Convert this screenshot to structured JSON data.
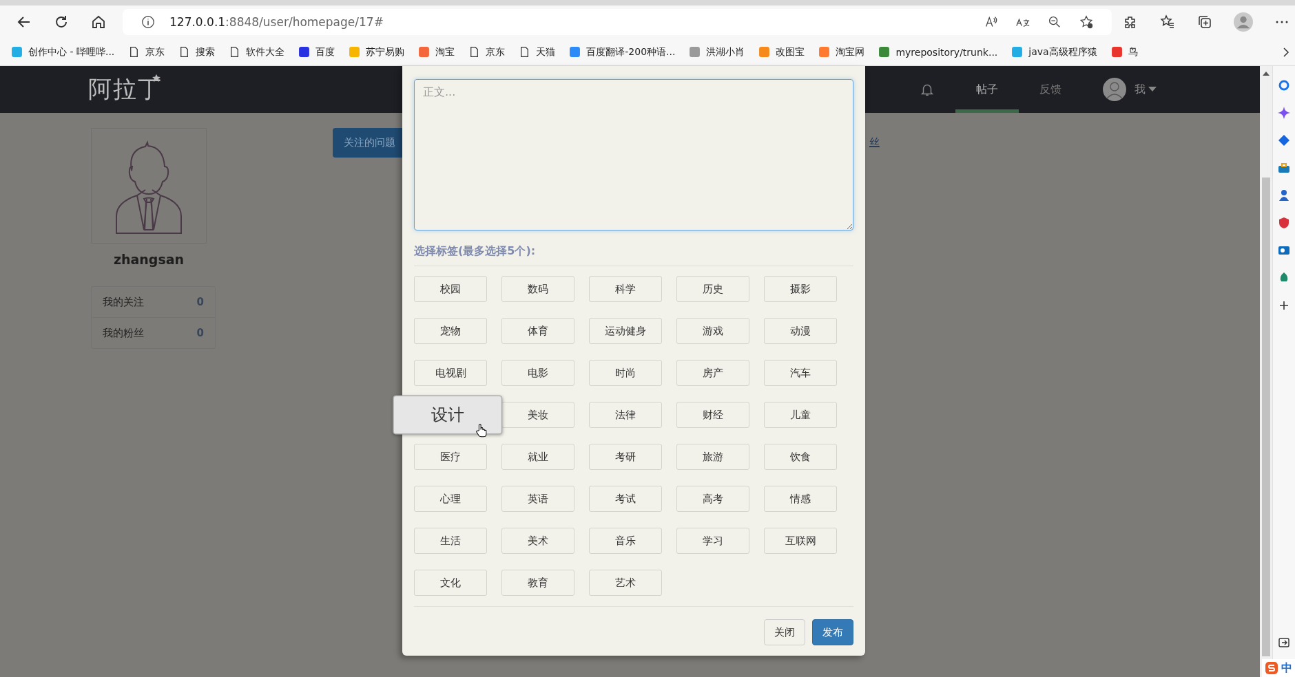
{
  "browser": {
    "url_host": "127.0.0.1",
    "url_path": ":8848/user/homepage/17#",
    "bookmarks": [
      {
        "label": "创作中心 - 哔哩哔...",
        "kind": "favicon",
        "color": "#23ade5"
      },
      {
        "label": "京东",
        "kind": "page"
      },
      {
        "label": "搜索",
        "kind": "page"
      },
      {
        "label": "软件大全",
        "kind": "page"
      },
      {
        "label": "百度",
        "kind": "favicon",
        "color": "#2932e1"
      },
      {
        "label": "苏宁易购",
        "kind": "favicon",
        "color": "#f7b500"
      },
      {
        "label": "淘宝",
        "kind": "favicon",
        "color": "#f4673a"
      },
      {
        "label": "京东",
        "kind": "page"
      },
      {
        "label": "天猫",
        "kind": "page"
      },
      {
        "label": "百度翻译-200种语...",
        "kind": "favicon",
        "color": "#2b8cf7"
      },
      {
        "label": "洪湖小肖",
        "kind": "favicon",
        "color": "#9a9a9a"
      },
      {
        "label": "改图宝",
        "kind": "favicon",
        "color": "#f78a1d"
      },
      {
        "label": "淘宝网",
        "kind": "favicon",
        "color": "#ff7a2e"
      },
      {
        "label": "myrepository/trunk...",
        "kind": "favicon",
        "color": "#3a8a3a"
      },
      {
        "label": "java高级程序猿",
        "kind": "favicon",
        "color": "#23ade5"
      },
      {
        "label": "鸟",
        "kind": "favicon",
        "color": "#e8342a"
      }
    ]
  },
  "navbar": {
    "logo": "阿拉丁",
    "items": [
      {
        "label": "帖子",
        "selected": true
      },
      {
        "label": "反馈",
        "selected": false
      }
    ],
    "user_label": "我"
  },
  "profile": {
    "username": "zhangsan",
    "stats": [
      {
        "label": "我的关注",
        "value": "0"
      },
      {
        "label": "我的粉丝",
        "value": "0"
      }
    ]
  },
  "main": {
    "button": "关注的问题",
    "link_fragment": "丝"
  },
  "modal": {
    "textarea_placeholder": "正文...",
    "tags_label": "选择标签(最多选择5个):",
    "tags": [
      {
        "label": "校园",
        "hovered": false
      },
      {
        "label": "数码",
        "hovered": false
      },
      {
        "label": "科学",
        "hovered": false
      },
      {
        "label": "历史",
        "hovered": false
      },
      {
        "label": "摄影",
        "hovered": false
      },
      {
        "label": "宠物",
        "hovered": false
      },
      {
        "label": "体育",
        "hovered": false
      },
      {
        "label": "运动健身",
        "hovered": false
      },
      {
        "label": "游戏",
        "hovered": false
      },
      {
        "label": "动漫",
        "hovered": false
      },
      {
        "label": "电视剧",
        "hovered": false
      },
      {
        "label": "电影",
        "hovered": false
      },
      {
        "label": "时尚",
        "hovered": false
      },
      {
        "label": "房产",
        "hovered": false
      },
      {
        "label": "汽车",
        "hovered": false
      },
      {
        "label": "设计",
        "hovered": true
      },
      {
        "label": "美妆",
        "hovered": false
      },
      {
        "label": "法律",
        "hovered": false
      },
      {
        "label": "财经",
        "hovered": false
      },
      {
        "label": "儿童",
        "hovered": false
      },
      {
        "label": "医疗",
        "hovered": false
      },
      {
        "label": "就业",
        "hovered": false
      },
      {
        "label": "考研",
        "hovered": false
      },
      {
        "label": "旅游",
        "hovered": false
      },
      {
        "label": "饮食",
        "hovered": false
      },
      {
        "label": "心理",
        "hovered": false
      },
      {
        "label": "英语",
        "hovered": false
      },
      {
        "label": "考试",
        "hovered": false
      },
      {
        "label": "高考",
        "hovered": false
      },
      {
        "label": "情感",
        "hovered": false
      },
      {
        "label": "生活",
        "hovered": false
      },
      {
        "label": "美术",
        "hovered": false
      },
      {
        "label": "音乐",
        "hovered": false
      },
      {
        "label": "学习",
        "hovered": false
      },
      {
        "label": "互联网",
        "hovered": false
      },
      {
        "label": "文化",
        "hovered": false
      },
      {
        "label": "教育",
        "hovered": false
      },
      {
        "label": "艺术",
        "hovered": false
      }
    ],
    "buttons": [
      {
        "label": "关闭",
        "kind": "default"
      },
      {
        "label": "发布",
        "kind": "primary"
      }
    ]
  },
  "ime": {
    "mode": "中"
  }
}
